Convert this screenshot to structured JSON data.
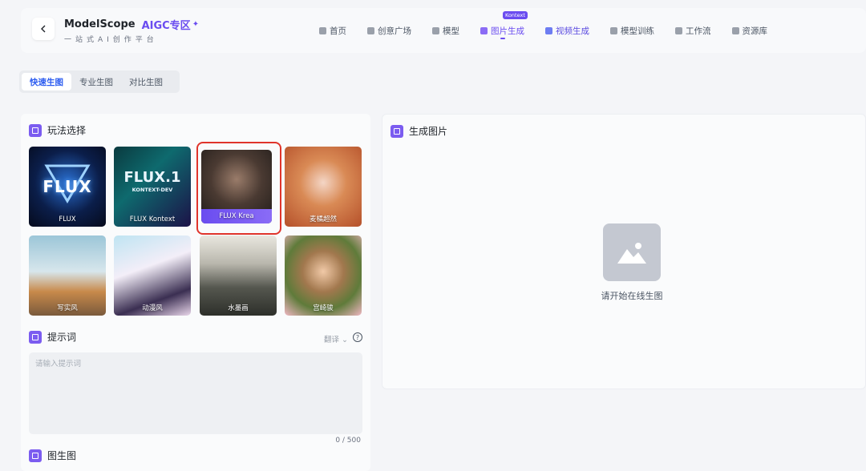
{
  "header": {
    "brand_name": "ModelScope",
    "brand_tag": "AIGC专区",
    "brand_subtitle": "一站式AI创作平台",
    "nav": [
      {
        "label": "首页",
        "icon": "home-icon"
      },
      {
        "label": "创意广场",
        "icon": "plaza-icon"
      },
      {
        "label": "模型",
        "icon": "cube-icon"
      },
      {
        "label": "图片生成",
        "icon": "image-gen-icon",
        "active": true,
        "badge": "Kontext"
      },
      {
        "label": "视频生成",
        "icon": "video-gen-icon"
      },
      {
        "label": "模型训练",
        "icon": "training-icon"
      },
      {
        "label": "工作流",
        "icon": "workflow-icon"
      },
      {
        "label": "资源库",
        "icon": "library-icon"
      }
    ]
  },
  "tabs": [
    "快速生图",
    "专业生图",
    "对比生图"
  ],
  "left": {
    "section_play": "玩法选择",
    "cards": [
      {
        "label": "FLUX",
        "art_text": "FLUX"
      },
      {
        "label": "FLUX Kontext",
        "art_text": "FLUX.1",
        "art_sub": "KONTEXT-DEV"
      },
      {
        "label": "FLUX Krea",
        "selected": true
      },
      {
        "label": "麦橘超然"
      },
      {
        "label": "写实风"
      },
      {
        "label": "动漫风"
      },
      {
        "label": "水墨画"
      },
      {
        "label": "宫崎骏"
      }
    ],
    "section_prompt": "提示词",
    "translate_label": "翻译",
    "prompt_placeholder": "请输入提示词",
    "counter": "0 / 500",
    "section_img2img": "图生图"
  },
  "right": {
    "title": "生成图片",
    "empty_text": "请开始在线生图"
  },
  "colors": {
    "accent": "#6a4cf0",
    "selection_border": "#e0342b",
    "tab_active": "#2c5cf0"
  }
}
